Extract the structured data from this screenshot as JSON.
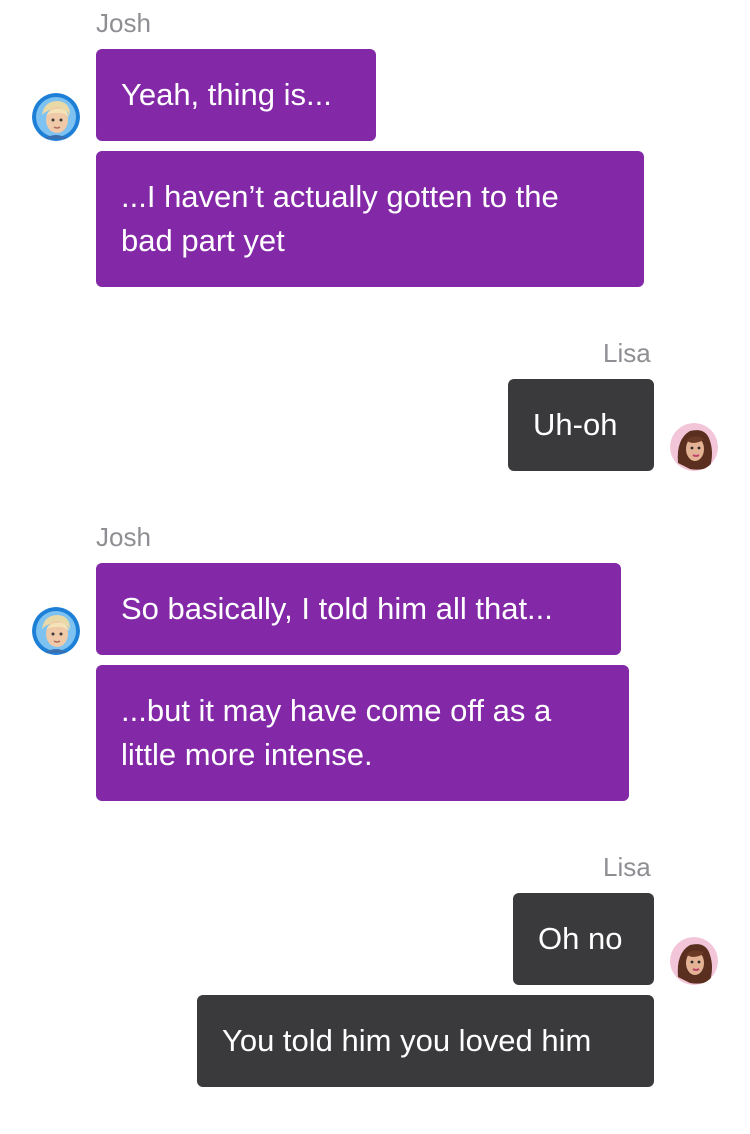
{
  "thread": {
    "groups": [
      {
        "sender": "Josh",
        "messages": [
          "Yeah, thing is...",
          "...I haven’t actually gotten to the bad part yet"
        ]
      },
      {
        "sender": "Lisa",
        "messages": [
          "Uh-oh"
        ]
      },
      {
        "sender": "Josh",
        "messages": [
          "So basically, I told him all that...",
          "...but it may have come off as a little more intense."
        ]
      },
      {
        "sender": "Lisa",
        "messages": [
          "Oh no",
          "You told him you loved him"
        ]
      }
    ]
  },
  "avatars": {
    "josh": "josh-avatar-icon",
    "lisa": "lisa-avatar-icon"
  },
  "colors": {
    "josh_bubble": "#8329a8",
    "lisa_bubble": "#3a3a3c",
    "name_text": "#8e8e93"
  }
}
